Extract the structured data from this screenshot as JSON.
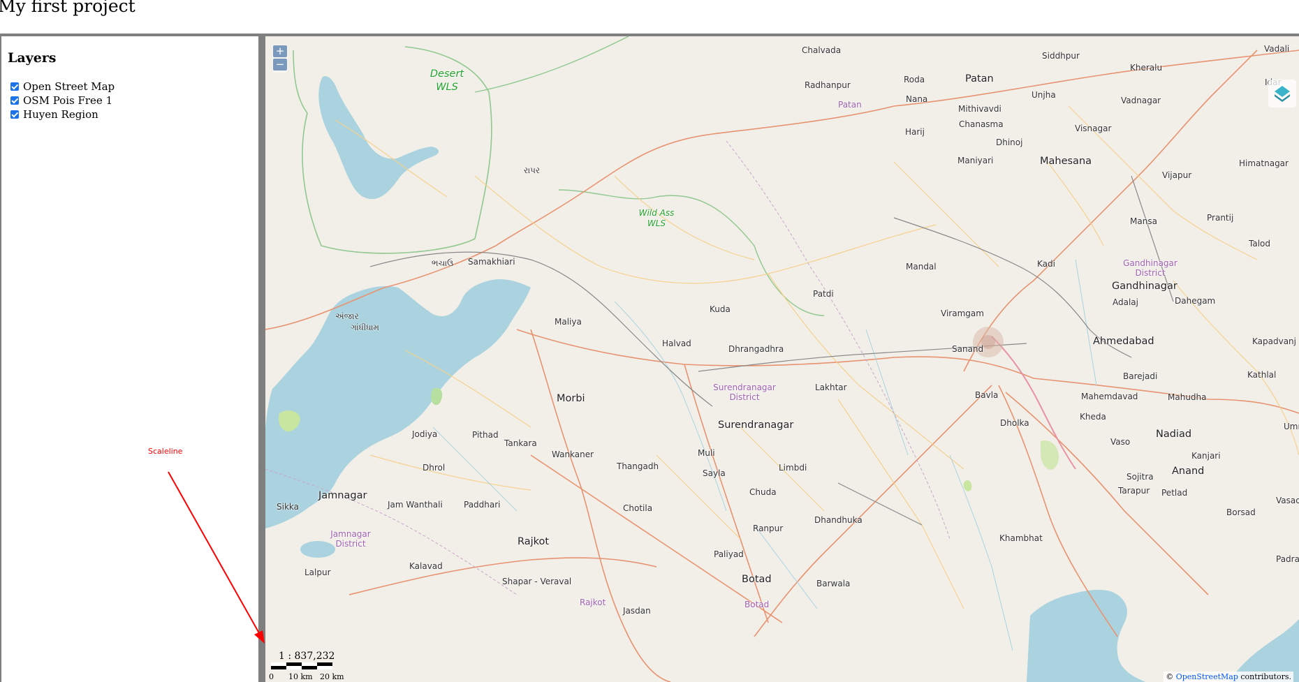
{
  "page": {
    "title": "My first project"
  },
  "sidebar": {
    "title": "Layers",
    "layers": [
      {
        "label": "Open Street Map",
        "checked": true
      },
      {
        "label": "OSM Pois Free 1",
        "checked": true
      },
      {
        "label": "Huyen Region",
        "checked": true
      }
    ]
  },
  "annotation": {
    "label": "Scaleline",
    "color": "#ff0000"
  },
  "map": {
    "zoom_in": "+",
    "zoom_out": "−",
    "scale_ratio": "1 : 837,232",
    "scale_labels": [
      "0",
      "10 km",
      "20 km"
    ],
    "attribution_prefix": "© ",
    "attribution_link": "OpenStreetMap",
    "attribution_suffix": " contributors.",
    "places": {
      "p1": "Chalvada",
      "p2": "Siddhpur",
      "p3": "Kheralu",
      "p4": "Vadali",
      "p5": "Radhanpur",
      "p6": "Roda",
      "p7": "Patan",
      "p8": "Unjha",
      "p9": "Idar",
      "p10": "Patan",
      "p11": "Nana",
      "p12": "Vadnagar",
      "p13": "Mithivavdi",
      "p14": "Chanasma",
      "p15": "Harij",
      "p16": "Visnagar",
      "p17": "Dhinoj",
      "p18": "Maniyari",
      "p19": "Mahesana",
      "p20": "Himatnagar",
      "p21": "રાપર",
      "p22": "Vijapur",
      "p23": "Mansa",
      "p24": "Prantij",
      "p25": "Talod",
      "p26": "ભચાઉ",
      "p27": "Samakhiari",
      "p28": "Mandal",
      "p29": "Kadi",
      "p30": "Gandhinagar District",
      "p31": "Gandhinagar",
      "p32": "Patdi",
      "p33": "Adalaj",
      "p34": "Dahegam",
      "p35": "અંજાર",
      "p36": "ગાંધીધામ",
      "p37": "Kuda",
      "p38": "Viramgam",
      "p39": "Maliya",
      "p40": "Halvad",
      "p41": "Dhrangadhra",
      "p42": "Sanand",
      "p43": "Ahmedabad",
      "p44": "Kapadvanj",
      "p45": "Lakhtar",
      "p46": "Barejadi",
      "p47": "Kathlal",
      "p48": "Surendranagar District",
      "p49": "Morbi",
      "p50": "Bavla",
      "p51": "Mahemdavad",
      "p52": "Mahudha",
      "p53": "Surendranagar",
      "p54": "Dholka",
      "p55": "Kheda",
      "p56": "Jodiya",
      "p57": "Pithad",
      "p58": "Tankara",
      "p59": "Vaso",
      "p60": "Nadiad",
      "p61": "Umret",
      "p62": "Wankaner",
      "p63": "Muli",
      "p64": "Kanjari",
      "p65": "Dhrol",
      "p66": "Thangadh",
      "p67": "Limbdi",
      "p68": "Sayla",
      "p69": "Anand",
      "p70": "Sojitra",
      "p71": "Chuda",
      "p72": "Tarapur",
      "p73": "Petlad",
      "p74": "Jamnagar",
      "p75": "Sikka",
      "p76": "Jam Wanthali",
      "p77": "Paddhari",
      "p78": "Chotila",
      "p79": "Borsad",
      "p80": "Vasad",
      "p81": "Dhandhuka",
      "p82": "Ranpur",
      "p83": "Jamnagar District",
      "p84": "Khambhat",
      "p85": "Rajkot",
      "p86": "Paliyad",
      "p87": "Padra",
      "p88": "Kalavad",
      "p89": "Lalpur",
      "p90": "Botad",
      "p91": "Shapar - Veraval",
      "p92": "Barwala",
      "p93": "Rajkot",
      "p94": "Jasdan",
      "p95": "Botad"
    },
    "parks": {
      "k1": "Desert WLS",
      "k2": "Wild Ass WLS"
    }
  }
}
